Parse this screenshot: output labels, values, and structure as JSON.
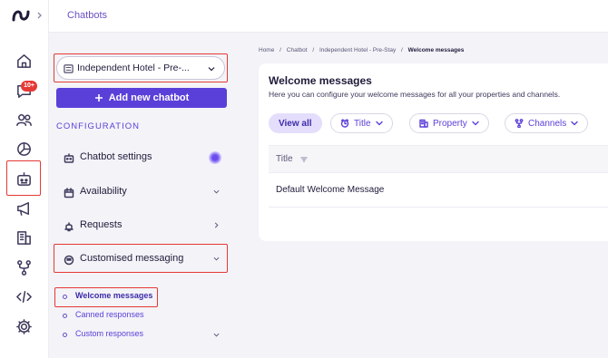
{
  "header": {
    "title": "Chatbots"
  },
  "rail": {
    "badge": "10+",
    "icons": [
      "logo-icon",
      "home-icon",
      "chat-icon",
      "guests-icon",
      "analytics-icon",
      "chatbot-icon",
      "campaigns-icon",
      "properties-icon",
      "integrations-icon",
      "code-icon",
      "settings-icon"
    ]
  },
  "sidebar": {
    "property_select": "Independent Hotel - Pre-...",
    "add_button": "Add new chatbot",
    "section_heading": "CONFIGURATION",
    "items": [
      {
        "label": "Chatbot settings",
        "icon": "bot-icon"
      },
      {
        "label": "Availability",
        "icon": "calendar-icon"
      },
      {
        "label": "Requests",
        "icon": "bell-icon"
      },
      {
        "label": "Customised messaging",
        "icon": "message-icon"
      }
    ],
    "sub_items": [
      {
        "label": "Welcome messages",
        "active": true
      },
      {
        "label": "Canned responses"
      },
      {
        "label": "Custom responses"
      }
    ]
  },
  "breadcrumb": [
    "Home",
    "/",
    "Chatbot",
    "/",
    "Independent Hotel - Pre-Stay",
    "/",
    "Welcome messages"
  ],
  "main": {
    "title": "Welcome messages",
    "description": "Here you can configure your welcome messages for all your properties and channels.",
    "filters": [
      "View all",
      "Title",
      "Property",
      "Channels"
    ],
    "table": {
      "columns": [
        "Title"
      ],
      "rows": [
        [
          "Default Welcome Message"
        ]
      ]
    }
  },
  "colors": {
    "accent": "#5b3fd9",
    "highlight": "#e53935",
    "badge": "#e53935"
  }
}
